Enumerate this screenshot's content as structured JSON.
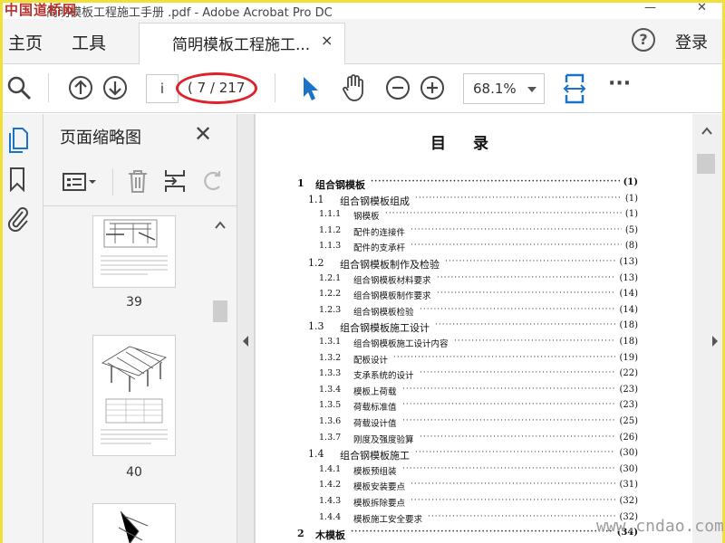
{
  "window": {
    "logo_text": "中国道桥网",
    "title": "简明模板工程施工手册 .pdf - Adobe Acrobat Pro DC",
    "minimize": "—",
    "close": "✕"
  },
  "menubar": {
    "home": "主页",
    "tools": "工具",
    "tab_title": "简明模板工程施工...",
    "tab_close": "×",
    "help": "?",
    "login": "登录"
  },
  "toolbar": {
    "page_current": "i",
    "page_count": "( 7 / 217",
    "zoom": "68.1%",
    "more": "···",
    "icons": [
      "search-icon",
      "prev-page-icon",
      "next-page-icon",
      "select-arrow-icon",
      "hand-icon",
      "zoom-out-icon",
      "zoom-in-icon",
      "fit-page-icon",
      "more-icon"
    ],
    "accent_color": "#1a73c8",
    "highlight_color": "#e0212a"
  },
  "thumb_panel": {
    "title": "页面缩略图",
    "close": "✕",
    "thumbs": [
      {
        "label": "39"
      },
      {
        "label": "40"
      }
    ]
  },
  "toc": {
    "title": "目录",
    "entries": [
      {
        "num": "1",
        "text": "组合钢模板",
        "page": "(1)",
        "level": 0
      },
      {
        "num": "1.1",
        "text": "组合钢模板组成",
        "page": "(1)",
        "level": 1
      },
      {
        "num": "1.1.1",
        "text": "钢模板",
        "page": "(1)",
        "level": 2
      },
      {
        "num": "1.1.2",
        "text": "配件的连接件",
        "page": "(5)",
        "level": 2
      },
      {
        "num": "1.1.3",
        "text": "配件的支承杆",
        "page": "(8)",
        "level": 2
      },
      {
        "num": "1.2",
        "text": "组合钢模板制作及检验",
        "page": "(13)",
        "level": 1
      },
      {
        "num": "1.2.1",
        "text": "组合钢模板材料要求",
        "page": "(13)",
        "level": 2
      },
      {
        "num": "1.2.2",
        "text": "组合钢模板制作要求",
        "page": "(14)",
        "level": 2
      },
      {
        "num": "1.2.3",
        "text": "组合钢模板检验",
        "page": "(14)",
        "level": 2
      },
      {
        "num": "1.3",
        "text": "组合钢模板施工设计",
        "page": "(18)",
        "level": 1
      },
      {
        "num": "1.3.1",
        "text": "组合钢模板施工设计内容",
        "page": "(18)",
        "level": 2
      },
      {
        "num": "1.3.2",
        "text": "配板设计",
        "page": "(19)",
        "level": 2
      },
      {
        "num": "1.3.3",
        "text": "支承系统的设计",
        "page": "(22)",
        "level": 2
      },
      {
        "num": "1.3.4",
        "text": "模板上荷载",
        "page": "(23)",
        "level": 2
      },
      {
        "num": "1.3.5",
        "text": "荷载标准值",
        "page": "(23)",
        "level": 2
      },
      {
        "num": "1.3.6",
        "text": "荷载设计值",
        "page": "(25)",
        "level": 2
      },
      {
        "num": "1.3.7",
        "text": "刚度及强度验算",
        "page": "(26)",
        "level": 2
      },
      {
        "num": "1.4",
        "text": "组合钢模板施工",
        "page": "(30)",
        "level": 1
      },
      {
        "num": "1.4.1",
        "text": "模板预组装",
        "page": "(30)",
        "level": 2
      },
      {
        "num": "1.4.2",
        "text": "模板安装要点",
        "page": "(31)",
        "level": 2
      },
      {
        "num": "1.4.3",
        "text": "模板拆除要点",
        "page": "(32)",
        "level": 2
      },
      {
        "num": "1.4.4",
        "text": "模板施工安全要求",
        "page": "(32)",
        "level": 2
      },
      {
        "num": "2",
        "text": "木模板",
        "page": "(34)",
        "level": 0
      }
    ]
  },
  "watermark": "www.cndao.com"
}
